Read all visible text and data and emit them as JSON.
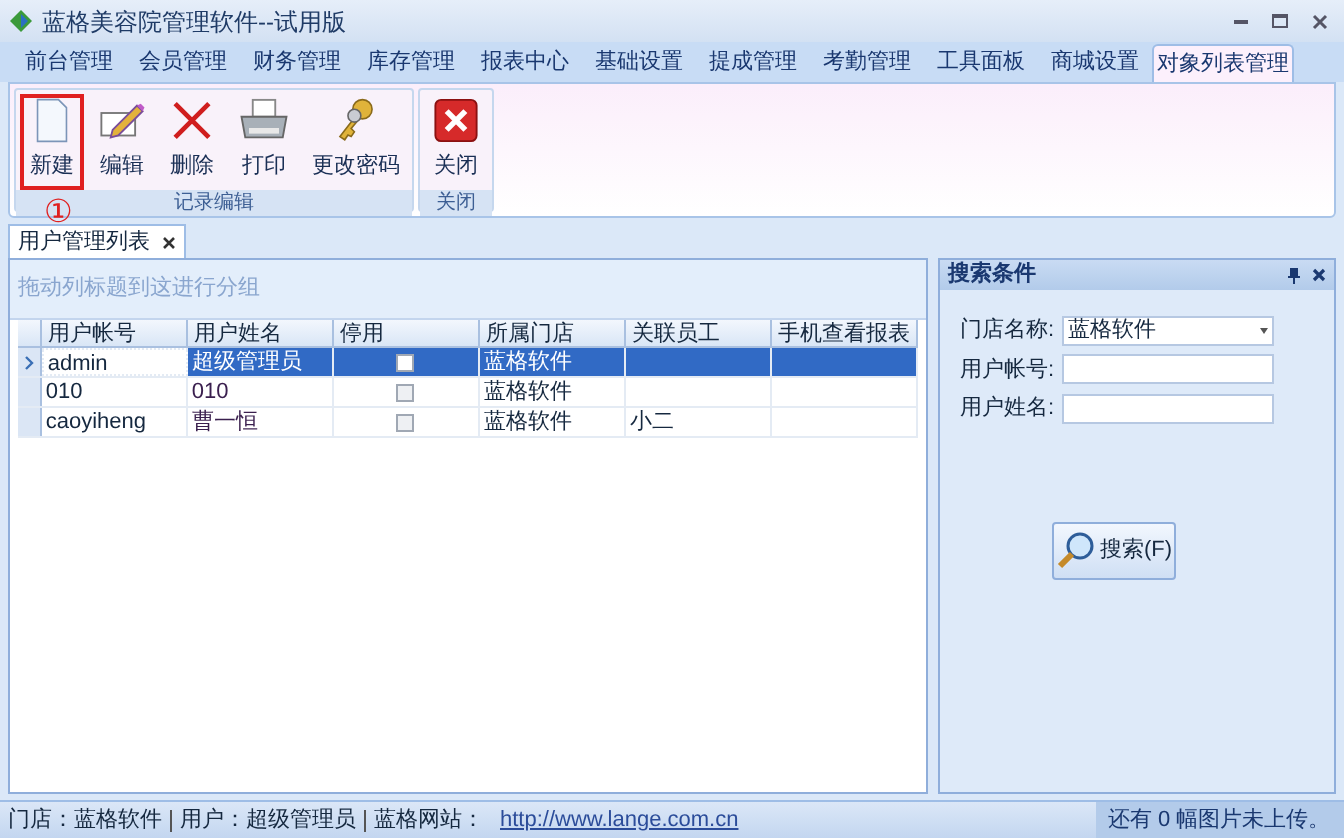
{
  "window": {
    "title": "蓝格美容院管理软件--试用版"
  },
  "menu_tabs": [
    {
      "label": "前台管理",
      "selected": false
    },
    {
      "label": "会员管理",
      "selected": false
    },
    {
      "label": "财务管理",
      "selected": false
    },
    {
      "label": "库存管理",
      "selected": false
    },
    {
      "label": "报表中心",
      "selected": false
    },
    {
      "label": "基础设置",
      "selected": false
    },
    {
      "label": "提成管理",
      "selected": false
    },
    {
      "label": "考勤管理",
      "selected": false
    },
    {
      "label": "工具面板",
      "selected": false
    },
    {
      "label": "商城设置",
      "selected": false
    },
    {
      "label": "对象列表管理",
      "selected": true
    }
  ],
  "ribbon_groups": [
    {
      "label": "记录编辑",
      "buttons": [
        {
          "label": "新建",
          "kind": "new",
          "highlighted": true
        },
        {
          "label": "编辑",
          "kind": "edit",
          "highlighted": false
        },
        {
          "label": "删除",
          "kind": "delete",
          "highlighted": false
        },
        {
          "label": "打印",
          "kind": "print",
          "highlighted": false
        },
        {
          "label": "更改密码",
          "kind": "password",
          "highlighted": false
        }
      ]
    },
    {
      "label": "关闭",
      "buttons": [
        {
          "label": "关闭",
          "kind": "close",
          "highlighted": false
        }
      ]
    }
  ],
  "annotation": "①",
  "document_tabs": [
    {
      "label": "用户管理列表",
      "selected": true
    }
  ],
  "grid": {
    "group_hint": "拖动列标题到这进行分组",
    "columns": [
      "用户帐号",
      "用户姓名",
      "停用",
      "所属门店",
      "关联员工",
      "手机查看报表"
    ],
    "rows": [
      {
        "selected": true,
        "account": "admin",
        "name": "超级管理员",
        "disabled": false,
        "store": "蓝格软件"
      },
      {
        "selected": false,
        "account": "010",
        "name": "010",
        "disabled": false,
        "store": "蓝格软件"
      },
      {
        "selected": false,
        "account": "caoyiheng",
        "name": "曹一恒",
        "disabled": false,
        "store": "蓝格软件",
        "employee": "小二"
      }
    ]
  },
  "search_panel": {
    "title": "搜索条件",
    "fields": [
      {
        "label": "门店名称:",
        "kind": "dropdown",
        "value": "蓝格软件"
      },
      {
        "label": "用户帐号:",
        "kind": "text"
      },
      {
        "label": "用户姓名:",
        "kind": "text"
      }
    ],
    "button": "搜索(F)"
  },
  "status_bar": {
    "items": [
      "门店：蓝格软件",
      "用户：超级管理员",
      "蓝格网站："
    ],
    "link": "http://www.lange.com.cn",
    "right": "还有 0 幅图片未上传。"
  }
}
